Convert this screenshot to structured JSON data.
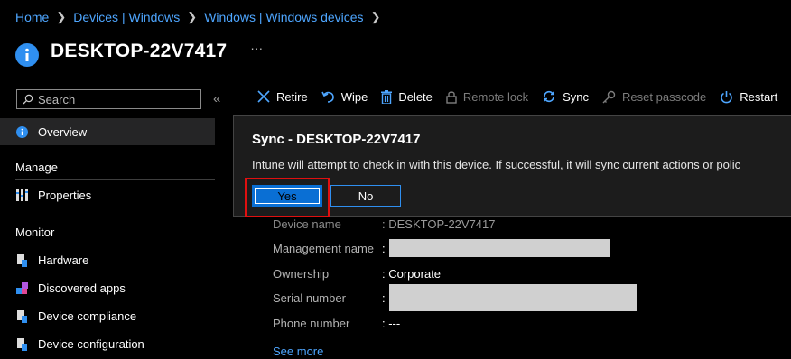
{
  "breadcrumb": [
    "Home",
    "Devices | Windows",
    "Windows | Windows devices"
  ],
  "device_title": "DESKTOP-22V7417",
  "more_label": "···",
  "search": {
    "placeholder": "Search"
  },
  "collapse_label": "«",
  "nav": {
    "overview": "Overview",
    "manage_header": "Manage",
    "properties": "Properties",
    "monitor_header": "Monitor",
    "hardware": "Hardware",
    "discovered_apps": "Discovered apps",
    "device_compliance": "Device compliance",
    "device_configuration": "Device configuration"
  },
  "toolbar": {
    "retire": "Retire",
    "wipe": "Wipe",
    "delete": "Delete",
    "remote_lock": "Remote lock",
    "sync": "Sync",
    "reset_passcode": "Reset passcode",
    "restart": "Restart"
  },
  "sync_dialog": {
    "title": "Sync - DESKTOP-22V7417",
    "message": "Intune will attempt to check in with this device. If successful, it will sync current actions or polic",
    "yes": "Yes",
    "no": "No"
  },
  "properties": {
    "device_name_label": "Device name",
    "device_name_value": ": DESKTOP-22V7417",
    "management_name_label": "Management name",
    "management_name_value": ":",
    "ownership_label": "Ownership",
    "ownership_value": ": Corporate",
    "serial_label": "Serial number",
    "serial_value": ":",
    "phone_label": "Phone number",
    "phone_value": ": ---"
  },
  "see_more": "See more",
  "colors": {
    "accent": "#2f8ff0",
    "link": "#4ea6ff",
    "highlight": "#e01010",
    "background": "#000000"
  }
}
